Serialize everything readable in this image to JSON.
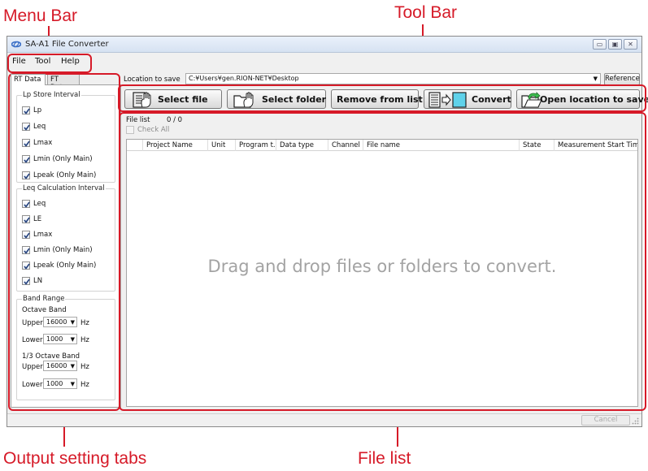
{
  "callouts": {
    "menu_bar": "Menu Bar",
    "tool_bar": "Tool Bar",
    "output_tabs": "Output setting tabs",
    "file_list": "File list"
  },
  "window": {
    "title": "SA-A1 File Converter",
    "controls": {
      "minimize": "▭",
      "maximize": "▣",
      "close": "✕"
    }
  },
  "menu": {
    "file": "File",
    "tool": "Tool",
    "help": "Help"
  },
  "tabs": {
    "rt": "RT Data",
    "ft": "FT Data"
  },
  "lp_group": {
    "title": "Lp Store Interval",
    "items": [
      {
        "label": "Lp",
        "checked": true
      },
      {
        "label": "Leq",
        "checked": true
      },
      {
        "label": "Lmax",
        "checked": true
      },
      {
        "label": "Lmin (Only Main)",
        "checked": true
      },
      {
        "label": "Lpeak (Only Main)",
        "checked": true
      }
    ]
  },
  "leq_group": {
    "title": "Leq Calculation Interval",
    "items": [
      {
        "label": "Leq",
        "checked": true
      },
      {
        "label": "LE",
        "checked": true
      },
      {
        "label": "Lmax",
        "checked": true
      },
      {
        "label": "Lmin (Only Main)",
        "checked": true
      },
      {
        "label": "Lpeak (Only Main)",
        "checked": true
      },
      {
        "label": "LN",
        "checked": true
      }
    ]
  },
  "band_range": {
    "title": "Band Range",
    "octave_label": "Octave Band",
    "third_octave_label": "1/3 Octave Band",
    "upper_label": "Upper",
    "lower_label": "Lower",
    "unit": "Hz",
    "octave_upper": "16000",
    "octave_lower": "1000",
    "third_upper": "16000",
    "third_lower": "1000"
  },
  "location": {
    "label": "Location to save",
    "path": "C:¥Users¥gen.RION-NET¥Desktop",
    "reference": "Reference"
  },
  "toolbar": {
    "select_file": "Select file",
    "select_folder": "Select folder",
    "remove": "Remove from list",
    "convert": "Convert",
    "open_location": "Open location to save"
  },
  "file_list": {
    "label": "File list",
    "count": "0 / 0",
    "check_all": "Check All",
    "columns": [
      "Project Name",
      "Unit",
      "Program t...",
      "Data type",
      "Channel",
      "File name",
      "State",
      "Measurement Start Time"
    ],
    "empty_hint": "Drag and drop files or folders to convert."
  },
  "status": {
    "cancel": "Cancel"
  },
  "colors": {
    "annotation": "#d61a28",
    "window_bg": "#f0f0f0"
  }
}
